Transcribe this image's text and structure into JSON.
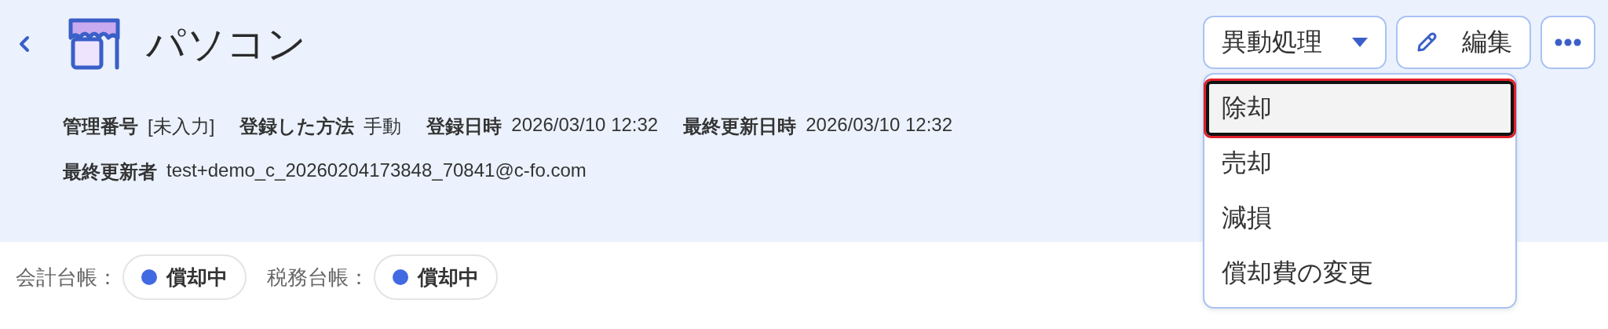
{
  "header": {
    "title": "パソコン",
    "actions": {
      "transfer_button": "異動処理",
      "edit_button": "編集"
    },
    "dropdown": [
      {
        "label": "除却",
        "selected": true
      },
      {
        "label": "売却",
        "selected": false
      },
      {
        "label": "減損",
        "selected": false
      },
      {
        "label": "償却費の変更",
        "selected": false
      }
    ],
    "meta_rows": [
      [
        {
          "label": "管理番号",
          "value": "[未入力]"
        },
        {
          "label": "登録した方法",
          "value": "手動"
        },
        {
          "label": "登録日時",
          "value": "2026/03/10 12:32"
        },
        {
          "label": "最終更新日時",
          "value": "2026/03/10 12:32"
        }
      ],
      [
        {
          "label": "最終更新者",
          "value": "test+demo_c_20260204173848_70841@c-fo.com"
        }
      ]
    ]
  },
  "ledgers": [
    {
      "label": "会計台帳：",
      "status": "償却中",
      "color": "#4169e1"
    },
    {
      "label": "税務台帳：",
      "status": "償却中",
      "color": "#4169e1"
    }
  ]
}
